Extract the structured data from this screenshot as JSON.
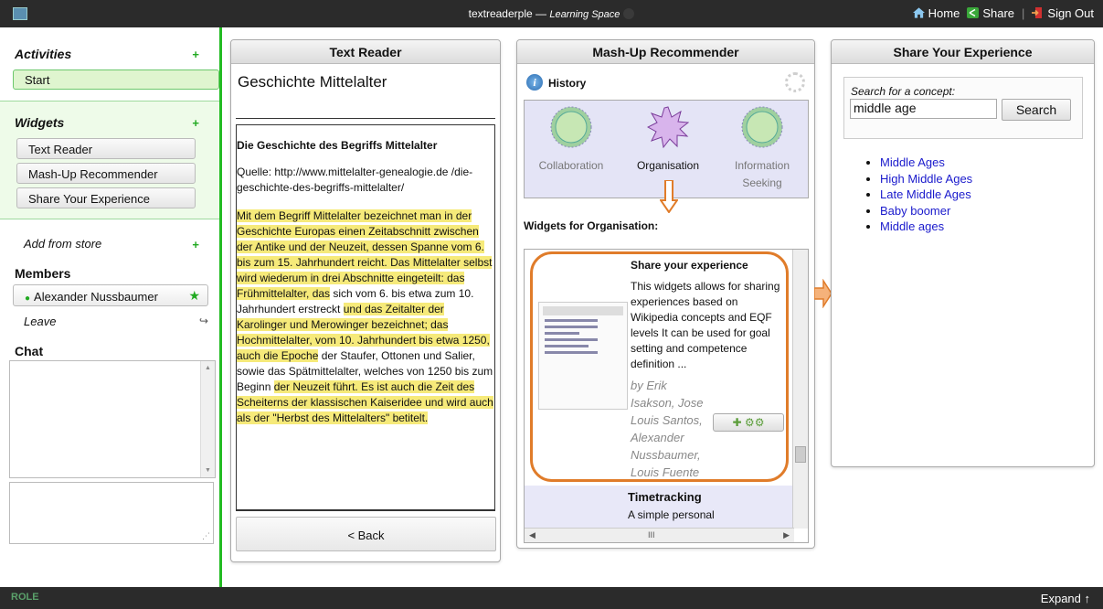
{
  "topbar": {
    "app_name": "textreaderple",
    "separator": " — ",
    "space_name": "Learning Space",
    "home_label": "Home",
    "share_label": "Share",
    "divider": "|",
    "signout_label": "Sign Out"
  },
  "sidebar": {
    "activities_label": "Activities",
    "plus": "+",
    "start_label": "Start",
    "widgets_label": "Widgets",
    "widgets": [
      "Text Reader",
      "Mash-Up Recommender",
      "Share Your Experience"
    ],
    "add_from_store": "Add from store",
    "members_label": "Members",
    "member_name": "Alexander Nussbaumer",
    "leave_label": "Leave",
    "chat_label": "Chat"
  },
  "reader": {
    "header": "Text Reader",
    "doc_title": "Geschichte Mittelalter",
    "article_heading": "Die Geschichte des Begriffs Mittelalter",
    "source": "Quelle: http://www.mittelalter-genealogie.de /die-geschichte-des-begriffs-mittelalter/",
    "text_a": "Mit dem Begriff Mittelalter bezeichnet man in der Geschichte Europas einen Zeitabschnitt zwischen der Antike und der Neuzeit, dessen Spanne vom 6. bis zum 15. Jahrhundert reicht. Das Mittelalter selbst wird wiederum in drei Abschnitte eingeteilt: das Frühmittelalter, das",
    "text_b": " sich vom 6. bis etwa zum 10. Jahrhundert erstreckt ",
    "text_c": "und das Zeitalter der Karolinger und Merowinger bezeichnet; das Hochmittelalter, vom 10. Jahrhundert bis etwa 1250, auch die Epoche",
    "text_d": " der Staufer, Ottonen und Salier, sowie das Spätmittelalter, welches von 1250 bis zum Beginn ",
    "text_e": "der Neuzeit führt. Es ist auch die Zeit des Scheiterns der klassischen Kaiseridee und wird auch als der \"Herbst des Mittelalters\" betitelt.",
    "back_label": "< Back"
  },
  "mashup": {
    "header": "Mash-Up Recommender",
    "info_glyph": "i",
    "history_label": "History",
    "nodes": [
      "Collaboration",
      "Organisation",
      "Information Seeking"
    ],
    "widgets_for_label": "Widgets for Organisation:",
    "card_title": "Share your experience",
    "card_desc": "This widgets allows for sharing experiences based on Wikipedia concepts and EQF levels It can be used for goal setting and competence definition ...",
    "card_authors": "by Erik Isakson, Jose Louis Santos, Alexander Nussbaumer, Louis Fuente",
    "next_title": "Timetracking",
    "next_desc": "A simple personal",
    "hscroll_mark": "III"
  },
  "share": {
    "header": "Share Your Experience",
    "search_label": "Search for a concept:",
    "search_value": "middle age",
    "search_button": "Search",
    "results": [
      "Middle Ages",
      "High Middle Ages",
      "Late Middle Ages",
      "Baby boomer",
      "Middle ages"
    ]
  },
  "bottombar": {
    "logo_text": "ROLE",
    "expand_label": "Expand ↑"
  },
  "colors": {
    "accent_green": "#22bb22",
    "highlight_yellow": "#f6ea7a",
    "card_orange": "#e07c2a",
    "link_blue": "#1a1acc"
  }
}
